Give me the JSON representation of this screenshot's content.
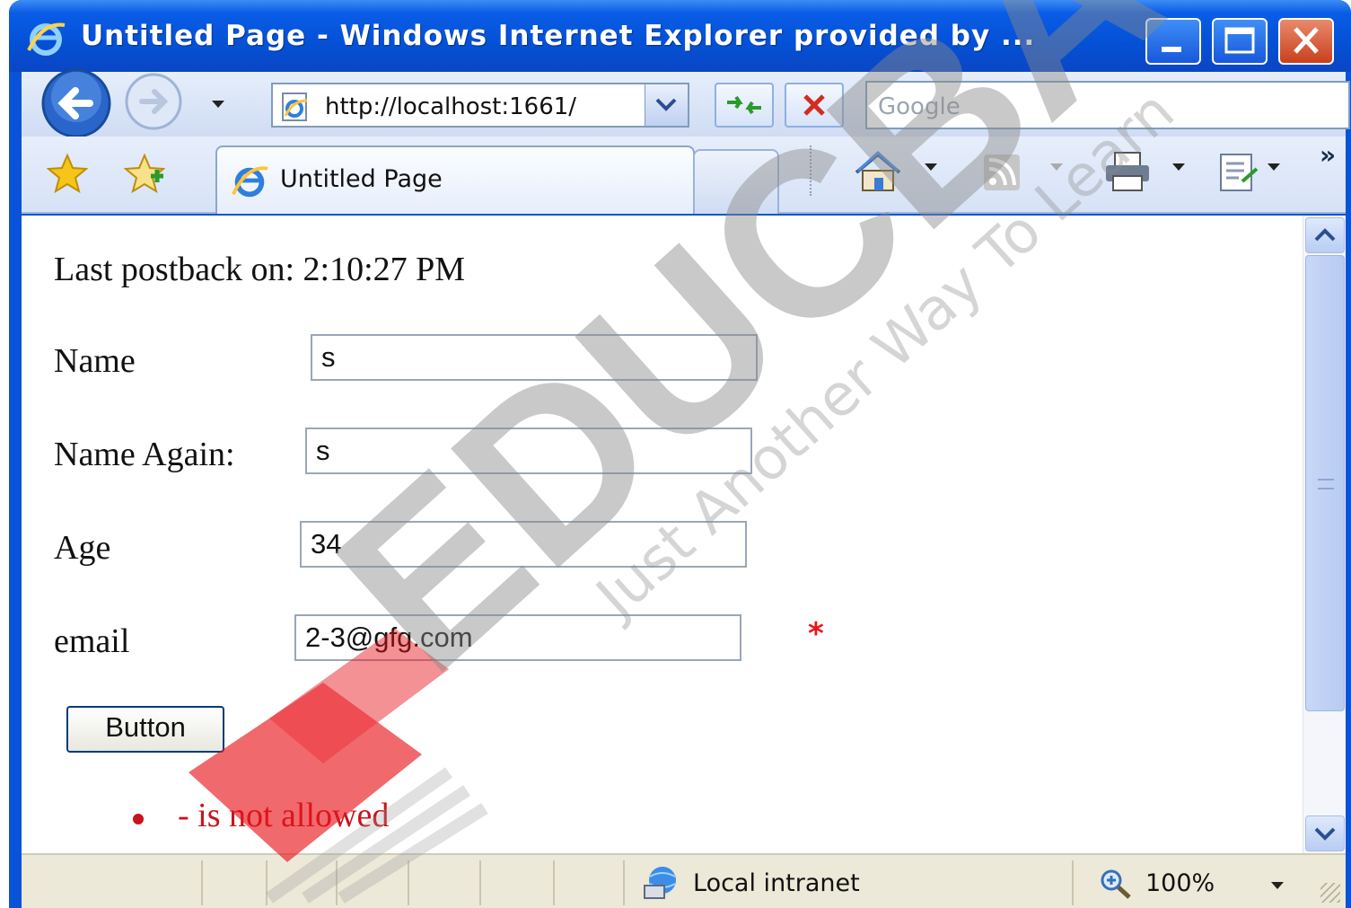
{
  "window": {
    "title": "Untitled Page - Windows Internet Explorer provided by ...",
    "title_icon": "ie-logo-icon"
  },
  "navbar": {
    "address": "http://localhost:1661/",
    "search_placeholder": "Google"
  },
  "tabbar": {
    "tab_label": "Untitled Page",
    "more": "»"
  },
  "page": {
    "postback_label": "Last postback on: 2:10:27 PM",
    "fields": [
      {
        "label": "Name",
        "value": "s"
      },
      {
        "label": "Name Again:",
        "value": "s"
      },
      {
        "label": "Age",
        "value": "34"
      },
      {
        "label": "email",
        "value": "2-3@gfg.com"
      }
    ],
    "validator_marker": "*",
    "button_label": "Button",
    "validation_summary": [
      "- is not allowed"
    ]
  },
  "statusbar": {
    "zone": "Local intranet",
    "zoom": "100%"
  },
  "watermark": {
    "brand": "EDUCBA",
    "tagline": "Just Another Way To Learn"
  },
  "colors": {
    "titlebar": "#0451d6",
    "validator": "#e8141b",
    "validation_text": "#c8141b",
    "watermark_red": "#e8141b",
    "watermark_gray": "#9a9a9a"
  }
}
